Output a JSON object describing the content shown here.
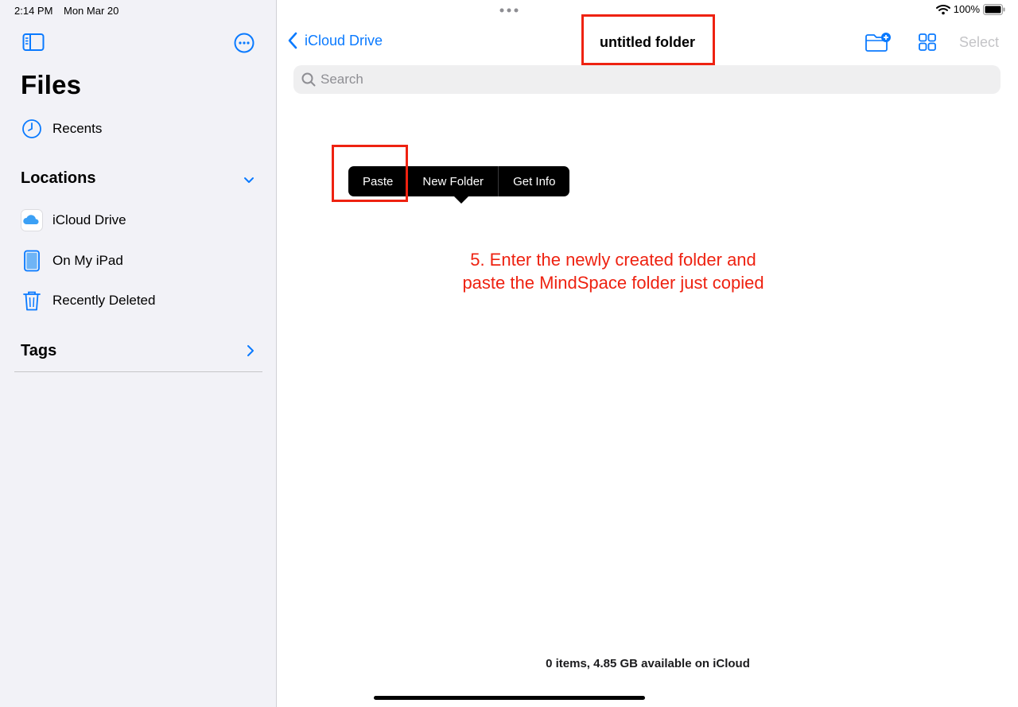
{
  "status_bar": {
    "time": "2:14 PM",
    "date": "Mon Mar 20",
    "battery": "100%"
  },
  "sidebar": {
    "title": "Files",
    "recents_label": "Recents",
    "locations_title": "Locations",
    "locations": [
      {
        "label": "iCloud Drive",
        "icon": "icloud-icon"
      },
      {
        "label": "On My iPad",
        "icon": "ipad-icon"
      },
      {
        "label": "Recently Deleted",
        "icon": "trash-icon"
      }
    ],
    "tags_title": "Tags"
  },
  "header": {
    "back_label": "iCloud Drive",
    "title": "untitled folder",
    "select_label": "Select"
  },
  "search": {
    "placeholder": "Search"
  },
  "context_menu": {
    "items": [
      "Paste",
      "New Folder",
      "Get Info"
    ]
  },
  "annotation": {
    "line1": "5. Enter the newly created folder and",
    "line2": "paste the MindSpace folder just copied"
  },
  "footer": {
    "status": "0 items, 4.85 GB available on iCloud"
  },
  "colors": {
    "accent": "#0a7aff",
    "highlight": "#ee2211",
    "sidebar_bg": "#f2f2f7"
  }
}
